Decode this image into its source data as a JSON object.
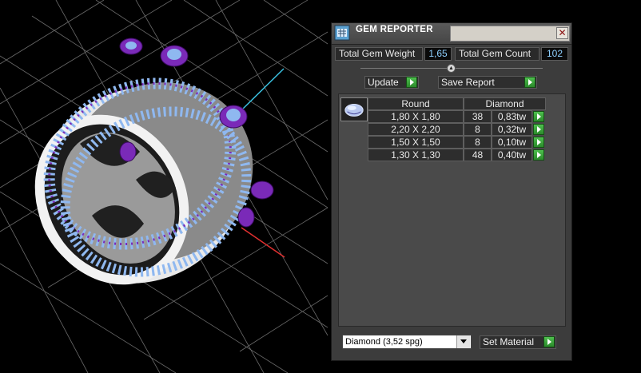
{
  "window": {
    "title": "GEM REPORTER",
    "close_glyph": "✕"
  },
  "summary": {
    "weight_label": "Total Gem Weight",
    "weight_value": "1,65",
    "count_label": "Total Gem Count",
    "count_value": "102"
  },
  "toolbar": {
    "update_label": "Update",
    "save_label": "Save Report"
  },
  "table": {
    "shape": "Round",
    "material": "Diamond",
    "rows": [
      {
        "size": "1,80 X 1,80",
        "count": "38",
        "weight": "0,83tw"
      },
      {
        "size": "2,20 X 2,20",
        "count": "8",
        "weight": "0,32tw"
      },
      {
        "size": "1,50 X 1,50",
        "count": "8",
        "weight": "0,10tw"
      },
      {
        "size": "1,30 X 1,30",
        "count": "48",
        "weight": "0,40tw"
      }
    ]
  },
  "material_select": {
    "value": "Diamond     (3,52 spg)"
  },
  "set_material_label": "Set Material",
  "colors": {
    "metal": "#c8c8c8",
    "prong_purple": "#7a2ab8",
    "gem_blue": "#8fb8f0",
    "grid": "#6a6a6a",
    "value_text": "#8fd0ff",
    "go_button": "#3aa83a"
  },
  "icons": [
    "gem-reporter-app-icon",
    "close-icon",
    "collapse-icon",
    "go-arrow-icon",
    "gem-round-icon",
    "dropdown-arrow-icon"
  ]
}
